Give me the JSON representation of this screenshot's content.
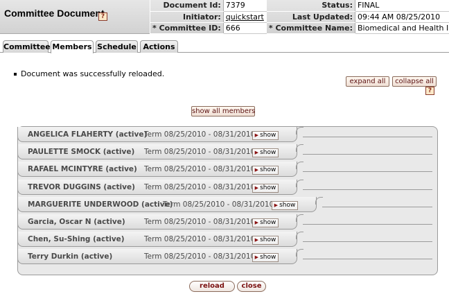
{
  "header": {
    "title": "Committee Document",
    "help_icon": "?",
    "labels": {
      "document_id": "Document Id:",
      "initiator": "Initiator:",
      "committee_id": "* Committee ID:",
      "status": "Status:",
      "last_updated": "Last Updated:",
      "committee_name": "* Committee Name:"
    },
    "values": {
      "document_id": "7379",
      "initiator": "quickstart",
      "committee_id": "666",
      "status": "FINAL",
      "last_updated": "09:44 AM 08/25/2010",
      "committee_name": "Biomedical and Health IRB"
    }
  },
  "tabs": [
    {
      "label": "Committee",
      "active": false
    },
    {
      "label": "Members",
      "active": true
    },
    {
      "label": "Schedule",
      "active": false
    },
    {
      "label": "Actions",
      "active": false
    }
  ],
  "message": "Document was successfully reloaded.",
  "controls": {
    "expand_all": "expand all",
    "collapse_all": "collapse all",
    "show_all_members": "show all members"
  },
  "members": [
    {
      "name": "ANGELICA FLAHERTY (active)",
      "term": "Term 08/25/2010 - 08/31/2010",
      "show": "show"
    },
    {
      "name": "PAULETTE SMOCK (active)",
      "term": "Term 08/25/2010 - 08/31/2010",
      "show": "show"
    },
    {
      "name": "RAFAEL MCINTYRE (active)",
      "term": "Term 08/25/2010 - 08/31/2010",
      "show": "show"
    },
    {
      "name": "TREVOR DUGGINS (active)",
      "term": "Term 08/25/2010 - 08/31/2010",
      "show": "show"
    },
    {
      "name": "MARGUERITE UNDERWOOD (active)",
      "term": "Term 08/25/2010 - 08/31/2010",
      "show": "show"
    },
    {
      "name": "Garcia, Oscar N (active)",
      "term": "Term 08/25/2010 - 08/31/2010",
      "show": "show"
    },
    {
      "name": "Chen, Su-Shing (active)",
      "term": "Term 08/25/2010 - 08/31/2010",
      "show": "show"
    },
    {
      "name": "Terry Durkin (active)",
      "term": "Term 08/25/2010 - 08/31/2010",
      "show": "show"
    }
  ],
  "footer": {
    "reload": "reload",
    "close": "close"
  }
}
